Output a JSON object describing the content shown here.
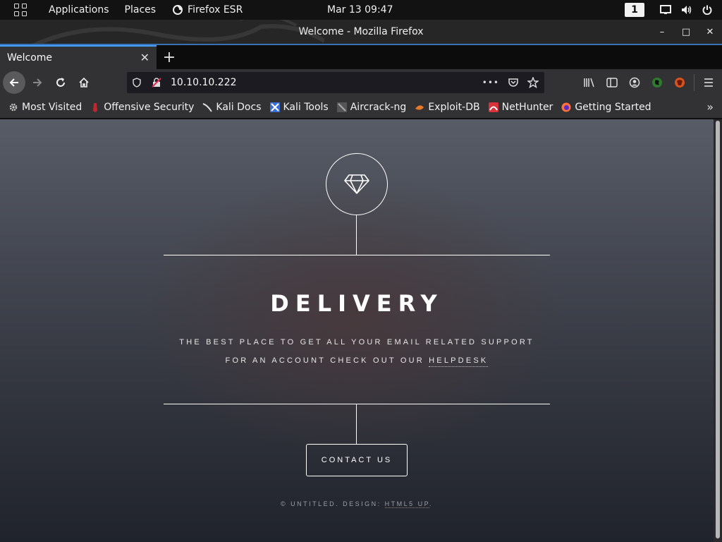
{
  "topbar": {
    "applications": "Applications",
    "places": "Places",
    "firefox": "Firefox ESR",
    "clock": "Mar 13  09:47",
    "workspace": "1"
  },
  "window": {
    "title": "Welcome - Mozilla Firefox",
    "minimize": "–",
    "maximize": "□",
    "close": "✕"
  },
  "tabs": [
    {
      "label": "Welcome",
      "close": "✕"
    }
  ],
  "new_tab": "+",
  "urlbar": {
    "url": "10.10.10.222",
    "more": "•••"
  },
  "bookmarks": [
    {
      "label": "Most Visited",
      "icon": "gear-icon",
      "color": "#cccccc"
    },
    {
      "label": "Offensive Security",
      "icon": "offsec-icon",
      "color": "#c0272d"
    },
    {
      "label": "Kali Docs",
      "icon": "kali-icon",
      "color": "#dddddd"
    },
    {
      "label": "Kali Tools",
      "icon": "kali-tools-icon",
      "color": "#3b6fd6"
    },
    {
      "label": "Aircrack-ng",
      "icon": "aircrack-icon",
      "color": "#888888"
    },
    {
      "label": "Exploit-DB",
      "icon": "exploitdb-icon",
      "color": "#e8782a"
    },
    {
      "label": "NetHunter",
      "icon": "nethunter-icon",
      "color": "#d8323b"
    },
    {
      "label": "Getting Started",
      "icon": "firefox-icon",
      "color": "#ff7139"
    }
  ],
  "bookmarks_more": "»",
  "page": {
    "title": "DELIVERY",
    "tagline_line1": "THE BEST PLACE TO GET ALL YOUR EMAIL RELATED SUPPORT",
    "tagline_line2_prefix": "FOR AN ACCOUNT CHECK OUT OUR ",
    "helpdesk_link": "HELPDESK",
    "contact_button": "CONTACT US",
    "footer_prefix": "© UNTITLED. DESIGN: ",
    "footer_link": "HTML5 UP",
    "footer_suffix": "."
  }
}
